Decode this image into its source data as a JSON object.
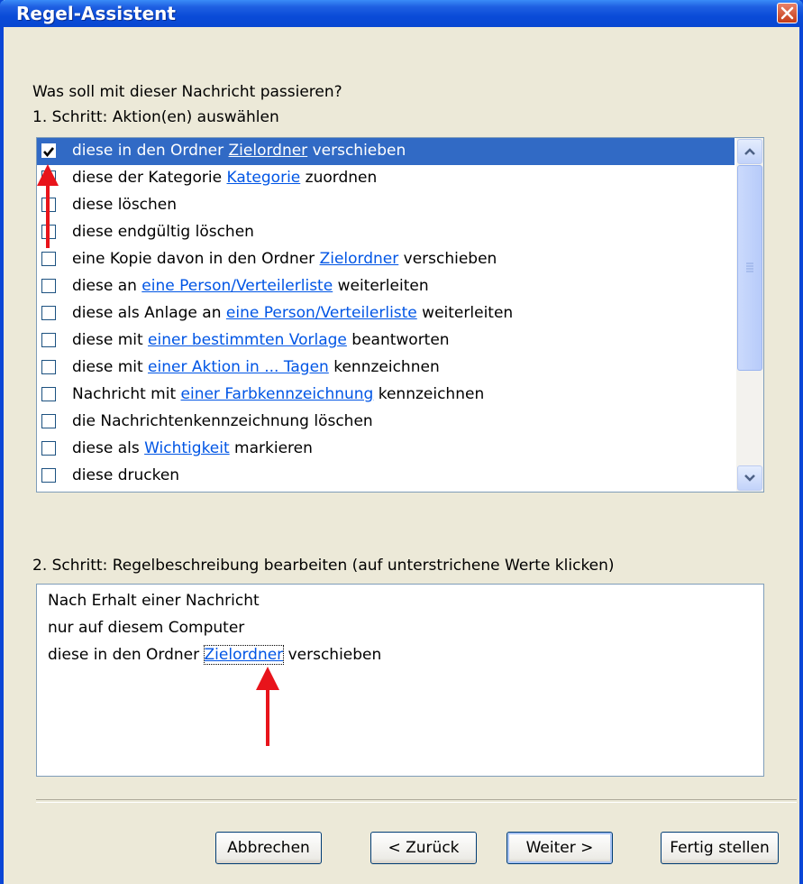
{
  "window": {
    "title": "Regel-Assistent"
  },
  "prompt": "Was soll mit dieser Nachricht passieren?",
  "step1_label": "1. Schritt: Aktion(en) auswählen",
  "actions": [
    {
      "checked": true,
      "pre": "diese in den Ordner ",
      "link": "Zielordner",
      "post": " verschieben"
    },
    {
      "checked": false,
      "pre": "diese der Kategorie ",
      "link": "Kategorie",
      "post": " zuordnen"
    },
    {
      "checked": false,
      "pre": "diese löschen",
      "link": "",
      "post": ""
    },
    {
      "checked": false,
      "pre": "diese endgültig löschen",
      "link": "",
      "post": ""
    },
    {
      "checked": false,
      "pre": "eine Kopie davon in den Ordner ",
      "link": "Zielordner",
      "post": " verschieben"
    },
    {
      "checked": false,
      "pre": "diese an ",
      "link": "eine Person/Verteilerliste",
      "post": " weiterleiten"
    },
    {
      "checked": false,
      "pre": "diese als Anlage an ",
      "link": "eine Person/Verteilerliste",
      "post": " weiterleiten"
    },
    {
      "checked": false,
      "pre": "diese mit ",
      "link": "einer bestimmten Vorlage",
      "post": " beantworten"
    },
    {
      "checked": false,
      "pre": "diese mit ",
      "link": "einer Aktion in ... Tagen",
      "post": " kennzeichnen"
    },
    {
      "checked": false,
      "pre": "Nachricht mit ",
      "link": "einer Farbkennzeichnung",
      "post": " kennzeichnen"
    },
    {
      "checked": false,
      "pre": "die Nachrichtenkennzeichnung löschen",
      "link": "",
      "post": ""
    },
    {
      "checked": false,
      "pre": "diese als ",
      "link": "Wichtigkeit",
      "post": " markieren"
    },
    {
      "checked": false,
      "pre": "diese drucken",
      "link": "",
      "post": ""
    }
  ],
  "step2_label": "2. Schritt: Regelbeschreibung bearbeiten (auf unterstrichene Werte klicken)",
  "description": {
    "line1": "Nach Erhalt einer Nachricht",
    "line2": "nur auf diesem Computer",
    "line3_pre": "diese in den Ordner ",
    "line3_link": "Zielordner",
    "line3_post": " verschieben"
  },
  "buttons": {
    "cancel": "Abbrechen",
    "back": "< Zurück",
    "next": "Weiter >",
    "finish": "Fertig stellen"
  },
  "colors": {
    "titlebar": "#0a4bd8",
    "selection": "#316ac5",
    "link": "#0055e5",
    "annotation_arrow": "#e8141b"
  }
}
